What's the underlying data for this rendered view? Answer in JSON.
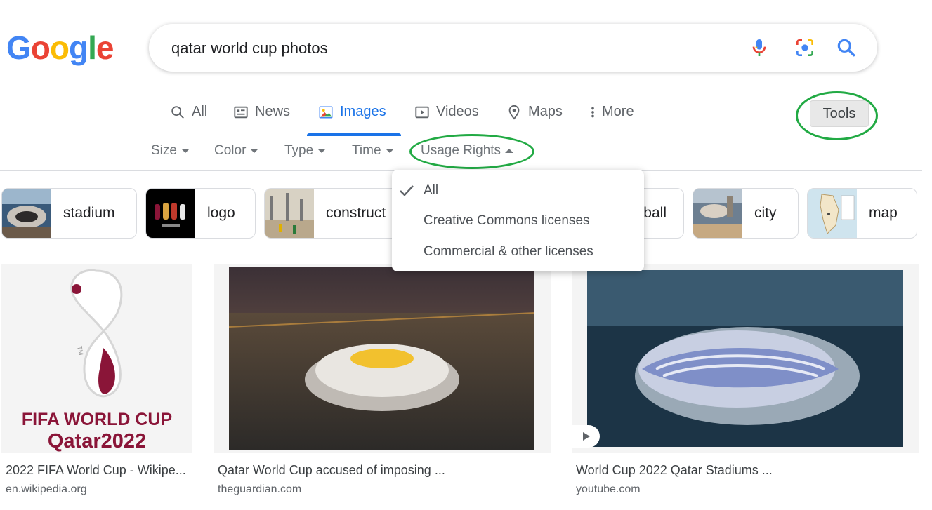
{
  "logo": {
    "letters": [
      "G",
      "o",
      "o",
      "g",
      "l",
      "e"
    ]
  },
  "search": {
    "query": "qatar world cup photos"
  },
  "tabs": [
    {
      "label": "All",
      "icon": "search-icon"
    },
    {
      "label": "News",
      "icon": "news-icon"
    },
    {
      "label": "Images",
      "icon": "images-icon",
      "active": true
    },
    {
      "label": "Videos",
      "icon": "video-icon"
    },
    {
      "label": "Maps",
      "icon": "map-pin-icon"
    },
    {
      "label": "More",
      "icon": "more-vert-icon"
    }
  ],
  "tools": {
    "label": "Tools"
  },
  "filters": [
    "Size",
    "Color",
    "Type",
    "Time",
    "Usage Rights"
  ],
  "chips": [
    "stadium",
    "logo",
    "construct",
    "ball",
    "city",
    "map"
  ],
  "usage_dropdown": {
    "options": [
      "All",
      "Creative Commons licenses",
      "Commercial & other licenses"
    ],
    "selected": "All"
  },
  "results": [
    {
      "title": "2022 FIFA World Cup - Wikipe...",
      "source": "en.wikipedia.org",
      "image_text": [
        "FIFA WORLD CUP",
        "Qatar2022"
      ],
      "image_mark": "TM"
    },
    {
      "title": "Qatar World Cup accused of imposing ...",
      "source": "theguardian.com"
    },
    {
      "title": "World Cup 2022 Qatar Stadiums ...",
      "source": "youtube.com"
    }
  ],
  "colors": {
    "accent": "#1a73e8",
    "annotation_ring": "#22aa44",
    "fifa_maroon": "#8a1538"
  }
}
